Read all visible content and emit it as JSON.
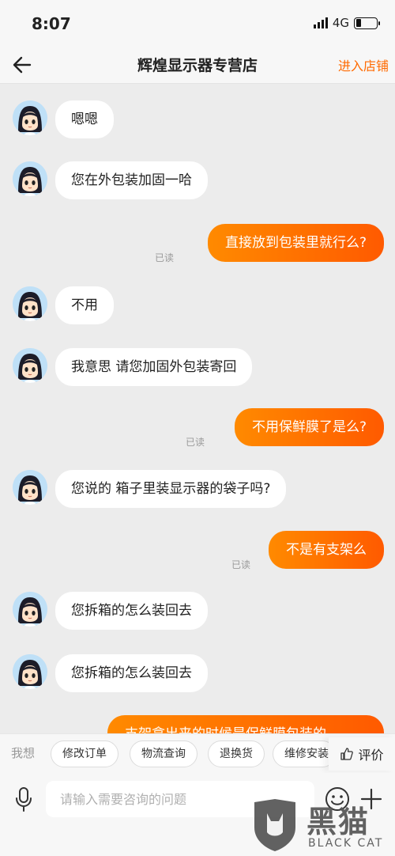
{
  "status_bar": {
    "time": "8:07",
    "network": "4G"
  },
  "header": {
    "title": "辉煌显示器专营店",
    "enter_shop": "进入店铺"
  },
  "messages": [
    {
      "side": "in",
      "text": "嗯嗯"
    },
    {
      "side": "in",
      "text": "您在外包装加固一哈"
    },
    {
      "side": "out",
      "text": "直接放到包装里就行么?",
      "status": "已读"
    },
    {
      "side": "in",
      "text": "不用"
    },
    {
      "side": "in",
      "text": "我意思 请您加固外包装寄回"
    },
    {
      "side": "out",
      "text": "不用保鲜膜了是么?",
      "status": "已读"
    },
    {
      "side": "in",
      "text": "您说的  箱子里装显示器的袋子吗?"
    },
    {
      "side": "out",
      "text": "不是有支架么",
      "status": "已读"
    },
    {
      "side": "in",
      "text": "您拆箱的怎么装回去"
    },
    {
      "side": "in",
      "text": "您拆箱的怎么装回去"
    },
    {
      "side": "out",
      "text": "支架拿出来的时候是保鲜膜包装的",
      "status": ""
    }
  ],
  "quick_bar": {
    "label": "我想",
    "chips": [
      "修改订单",
      "物流查询",
      "退换货",
      "维修安装"
    ],
    "review": "评价"
  },
  "input": {
    "placeholder": "请输入需要咨询的问题",
    "value": ""
  },
  "watermark": {
    "title": "黑猫",
    "subtitle": "BLACK CAT"
  },
  "colors": {
    "accent": "#ff6a00",
    "bubble_out_start": "#ff8a00",
    "bubble_out_end": "#ff5a00",
    "background": "#ececec"
  },
  "icons": {
    "back": "arrow-left-icon",
    "mic": "microphone-icon",
    "emoji": "emoji-icon",
    "plus": "plus-icon",
    "review": "thumbs-up-icon"
  }
}
